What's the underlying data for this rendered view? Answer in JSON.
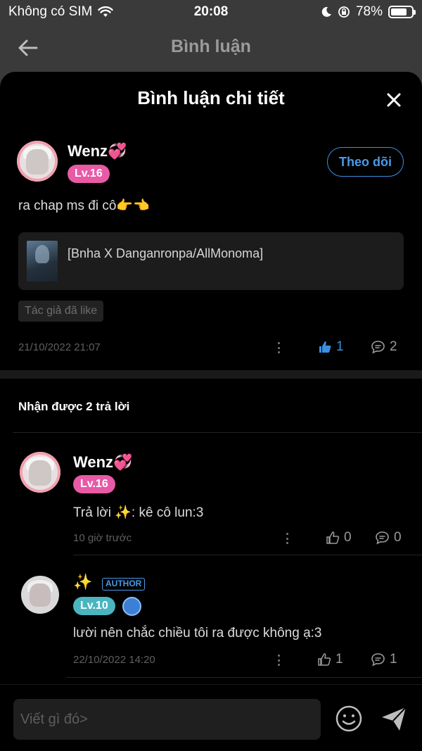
{
  "status": {
    "carrier": "Không có SIM",
    "time": "20:08",
    "battery": "78%",
    "battery_level": 0.78
  },
  "navbar": {
    "title": "Bình luận"
  },
  "sheet": {
    "title": "Bình luận chi tiết"
  },
  "comment": {
    "author": "Wenz💞",
    "level": "Lv.16",
    "follow_label": "Theo dõi",
    "text": "ra chap ms đi cô👉👈",
    "book_title": "[Bnha X Danganronpa/AllMonoma]",
    "liked_tag": "Tác giả đã like",
    "time": "21/10/2022 21:07",
    "likes": "1",
    "replies": "2"
  },
  "replies_header": "Nhận được 2 trả lời",
  "replies": [
    {
      "author": "Wenz💞",
      "level": "Lv.16",
      "text": "Trả lời ✨: kê cô lun:3",
      "time": "10 giờ trước",
      "likes": "0",
      "replies": "0"
    },
    {
      "author": "✨",
      "badge": "AUTHOR",
      "level": "Lv.10",
      "text": "lười nên chắc chiều tôi ra được không ạ:3",
      "time": "22/10/2022 14:20",
      "likes": "1",
      "replies": "1"
    }
  ],
  "composer": {
    "placeholder": "Viết gì đó>"
  },
  "colors": {
    "accent": "#3b8fe0",
    "pink": "#e85aa6",
    "teal": "#4ab5c0"
  }
}
